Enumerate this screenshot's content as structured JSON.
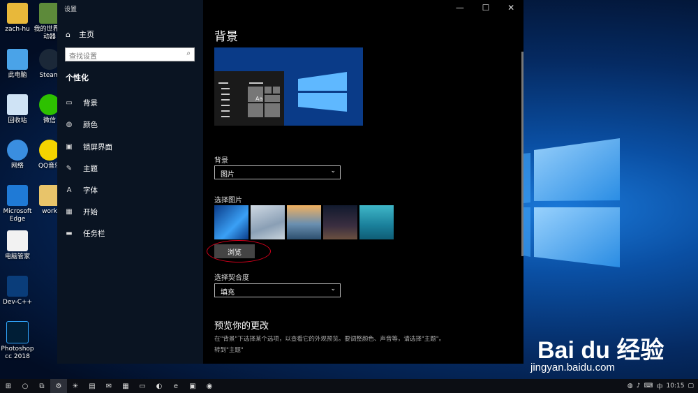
{
  "desktop": {
    "icons": [
      {
        "label": "zach-hu",
        "icon": "user-folder-icon"
      },
      {
        "label": "我的世界启动器",
        "icon": "minecraft-icon"
      },
      {
        "label": "此电脑",
        "icon": "computer-icon"
      },
      {
        "label": "Steam",
        "icon": "steam-icon"
      },
      {
        "label": "回收站",
        "icon": "recycle-bin-icon"
      },
      {
        "label": "微信",
        "icon": "wechat-icon"
      },
      {
        "label": "网络",
        "icon": "network-icon"
      },
      {
        "label": "QQ音乐",
        "icon": "qq-music-icon"
      },
      {
        "label": "Microsoft Edge",
        "icon": "edge-icon"
      },
      {
        "label": "work",
        "icon": "folder-icon"
      },
      {
        "label": "电脑管家",
        "icon": "pc-manager-icon"
      },
      {
        "label": "Dev-C++",
        "icon": "dev-cpp-icon"
      },
      {
        "label": "Photoshop cc 2018",
        "icon": "photoshop-icon"
      }
    ]
  },
  "window": {
    "title": "设置",
    "controls": {
      "minimize": "—",
      "maximize": "☐",
      "close": "✕"
    }
  },
  "nav": {
    "home": "主页",
    "search_placeholder": "查找设置",
    "section": "个性化",
    "items": [
      {
        "label": "背景",
        "icon": "picture-icon"
      },
      {
        "label": "颜色",
        "icon": "palette-icon"
      },
      {
        "label": "锁屏界面",
        "icon": "lock-screen-icon"
      },
      {
        "label": "主题",
        "icon": "theme-icon"
      },
      {
        "label": "字体",
        "icon": "font-icon"
      },
      {
        "label": "开始",
        "icon": "start-icon"
      },
      {
        "label": "任务栏",
        "icon": "taskbar-icon"
      }
    ]
  },
  "content": {
    "heading": "背景",
    "preview_tile": "Aa",
    "background_label": "背景",
    "background_value": "图片",
    "choose_picture_label": "选择图片",
    "browse_button": "浏览",
    "fit_label": "选择契合度",
    "fit_value": "填充",
    "preview_heading": "预览你的更改",
    "preview_desc": "在\"背景\"下选择某个选项，以查看它的外观预览。要调整颜色、声音等，请选择\"主题\"。",
    "themes_link": "转到\"主题\""
  },
  "taskbar": {
    "clock": "10:15",
    "ime": "中",
    "tray_icons": [
      "network-icon",
      "volume-icon",
      "keyboard-icon",
      "notification-icon"
    ]
  },
  "watermark": {
    "brand": "Bai du 经验",
    "url": "jingyan.baidu.com"
  },
  "colors": {
    "accent": "#0078d7",
    "highlight_ring": "#d6001c"
  }
}
